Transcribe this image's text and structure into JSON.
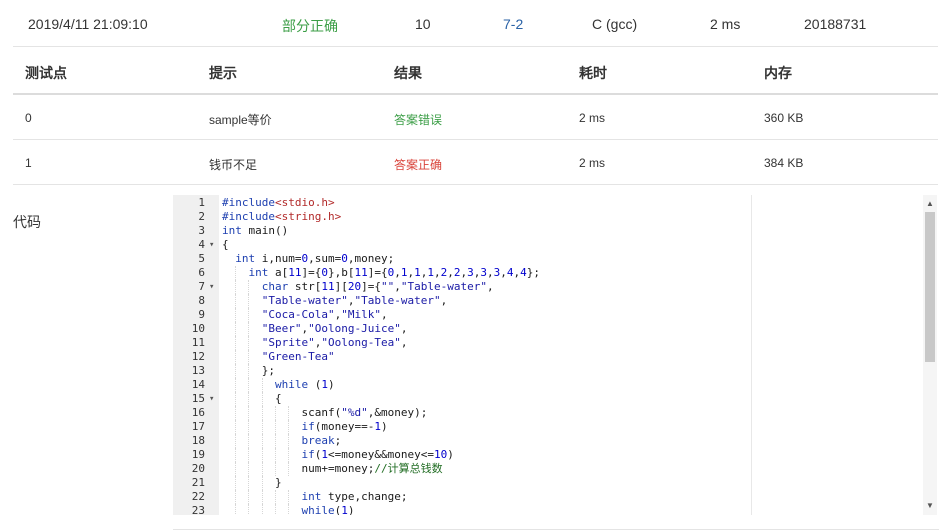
{
  "summary": {
    "time": "2019/4/11 21:09:10",
    "status": "部分正确",
    "score": "10",
    "problem": "7-2",
    "compiler": "C (gcc)",
    "duration": "2 ms",
    "user": "20188731"
  },
  "cases": {
    "headers": [
      "测试点",
      "提示",
      "结果",
      "耗时",
      "内存"
    ],
    "rows": [
      {
        "id": "0",
        "hint": "sample等价",
        "result": "答案错误",
        "time": "2 ms",
        "memory": "360 KB"
      },
      {
        "id": "1",
        "hint": "钱币不足",
        "result": "答案正确",
        "time": "2 ms",
        "memory": "384 KB"
      }
    ]
  },
  "code_label": "代码",
  "colors": {
    "ok": "#3c9e47",
    "err": "#d9433a",
    "link": "#2a62a6"
  },
  "code": {
    "fold_lines": [
      4,
      7,
      15
    ],
    "lines": [
      "#include<stdio.h>",
      "#include<string.h>",
      "int main()",
      "{",
      "  int i,num=0,sum=0,money;",
      "    int a[11]={0},b[11]={0,1,1,1,2,2,3,3,3,4,4};",
      "      char str[11][20]={\"\",\"Table-water\",",
      "      \"Table-water\",\"Table-water\",",
      "      \"Coca-Cola\",\"Milk\",",
      "      \"Beer\",\"Oolong-Juice\",",
      "      \"Sprite\",\"Oolong-Tea\",",
      "      \"Green-Tea\"",
      "      };",
      "        while (1)",
      "        {",
      "            scanf(\"%d\",&money);",
      "            if(money==-1)",
      "            break;",
      "            if(1<=money&&money<=10)",
      "            num+=money;//计算总钱数",
      "        }",
      "            int type,change;",
      "            while(1)"
    ]
  },
  "icons": {
    "fold": "caret-down-icon",
    "scroll_up": "arrow-up-icon",
    "scroll_down": "arrow-down-icon"
  }
}
